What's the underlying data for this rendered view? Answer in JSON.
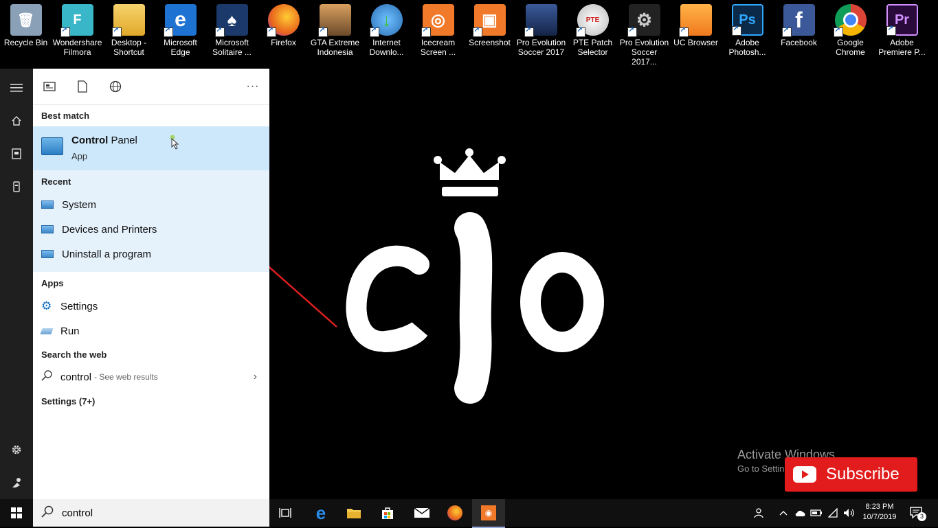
{
  "desktop": {
    "icons": [
      {
        "label": "Recycle Bin",
        "icon": "recycle-bin-icon",
        "color": "#7a8fa6",
        "glyph": "🗑"
      },
      {
        "label": "Wondershare\nFilmora",
        "icon": "filmora-icon",
        "color": "#39b7c9",
        "glyph": "F"
      },
      {
        "label": "Desktop -\nShortcut",
        "icon": "folder-icon",
        "color": "#f2c94c",
        "glyph": ""
      },
      {
        "label": "Microsoft\nEdge",
        "icon": "edge-icon",
        "color": "#1e73d2",
        "glyph": "e"
      },
      {
        "label": "Microsoft\nSolitaire ...",
        "icon": "solitaire-icon",
        "color": "#1b3a6b",
        "glyph": "♠"
      },
      {
        "label": "Firefox",
        "icon": "firefox-icon",
        "color": "#e8651d",
        "glyph": ""
      },
      {
        "label": "GTA Extreme\nIndonesia",
        "icon": "gta-icon",
        "color": "#b07a42",
        "glyph": ""
      },
      {
        "label": "Internet\nDownlo...",
        "icon": "idm-icon",
        "color": "#3f9a3f",
        "glyph": "↓"
      },
      {
        "label": "Icecream\nScreen ...",
        "icon": "icecream-icon",
        "color": "#f07a2a",
        "glyph": "◎"
      },
      {
        "label": "Screenshot",
        "icon": "screenshot-icon",
        "color": "#f07a2a",
        "glyph": "▣"
      },
      {
        "label": "Pro Evolution\nSoccer 2017",
        "icon": "pes2017-icon",
        "color": "#223a6b",
        "glyph": ""
      },
      {
        "label": "PTE Patch\nSelector",
        "icon": "pte-patch-icon",
        "color": "#e0e0e0",
        "glyph": ""
      },
      {
        "label": "Pro Evolution\nSoccer 2017...",
        "icon": "pes-settings-icon",
        "color": "#333333",
        "glyph": "⚙"
      },
      {
        "label": "UC Browser",
        "icon": "uc-browser-icon",
        "color": "#f39a1e",
        "glyph": ""
      },
      {
        "label": "Adobe\nPhotosh...",
        "icon": "photoshop-icon",
        "color": "#0b2a4a",
        "glyph": "Ps"
      },
      {
        "label": "Facebook",
        "icon": "facebook-icon",
        "color": "#3b5998",
        "glyph": "f"
      },
      {
        "label": "Google\nChrome",
        "icon": "chrome-icon",
        "color": "#e04a3a",
        "glyph": ""
      },
      {
        "label": "Adobe\nPremiere P...",
        "icon": "premiere-icon",
        "color": "#2a0a3a",
        "glyph": "Pr"
      }
    ]
  },
  "watermark": {
    "activate_title": "Activate Windows",
    "activate_sub": "Go to Settings to activate Windows."
  },
  "subscribe": {
    "label": "Subscribe",
    "color": "#e21c1c"
  },
  "start_menu": {
    "rail": [
      "hamburger-icon",
      "home-icon",
      "documents-icon",
      "device-icon",
      "settings-icon",
      "user-icon"
    ],
    "toolbar": [
      "apps-filter-icon",
      "documents-filter-icon",
      "web-filter-icon",
      "more-icon"
    ],
    "best_match_header": "Best match",
    "best_match": {
      "title_bold": "Control",
      "title_rest": " Panel",
      "subtitle": "App"
    },
    "recent_header": "Recent",
    "recent": [
      "System",
      "Devices and Printers",
      "Uninstall a program"
    ],
    "apps_header": "Apps",
    "apps": [
      "Settings",
      "Run"
    ],
    "web_header": "Search the web",
    "web": {
      "query": "control",
      "hint": "- See web results"
    },
    "settings_header": "Settings (7+)"
  },
  "taskbar": {
    "search_value": "control",
    "apps": [
      "task-view-icon",
      "edge-icon",
      "file-explorer-icon",
      "store-icon",
      "mail-icon",
      "firefox-icon",
      "screenshot-icon"
    ],
    "clock_time": "8:23 PM",
    "clock_date": "10/7/2019",
    "notification_count": "3"
  },
  "colors": {
    "accent": "#cde8fb",
    "recent_bg": "#e5f1fb",
    "arrow": "#e02020"
  }
}
